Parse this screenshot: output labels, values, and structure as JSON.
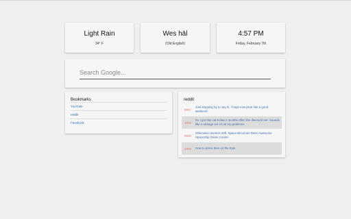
{
  "cards": {
    "weather": {
      "main": "Light Rain",
      "sub": "34° F"
    },
    "phrase": {
      "main": "Wes hāl",
      "sub": "(Old English)"
    },
    "clock": {
      "main": "4:57 PM",
      "sub": "Friday, February 7th"
    }
  },
  "search": {
    "placeholder": "Search Google..."
  },
  "bookmarks": {
    "title": "Bookmarks",
    "items": [
      "YouTube",
      "reddit",
      "Facebook"
    ]
  },
  "reddit": {
    "title": "reddit",
    "items": [
      {
        "score": "8827",
        "text": "Just stopping by to say hi. I hope everyone has a good weekend"
      },
      {
        "score": "3665",
        "text": "So I got this cat Kolaa 2 months after she divorced me. Sounds like a strange set of cat my problems"
      },
      {
        "score": "3640",
        "text": "Otherwise Useless 40ft. Space Becomes Retro Awesome Spaceship Game Center"
      },
      {
        "score": "4669",
        "text": "How to press tires on the train"
      }
    ]
  }
}
